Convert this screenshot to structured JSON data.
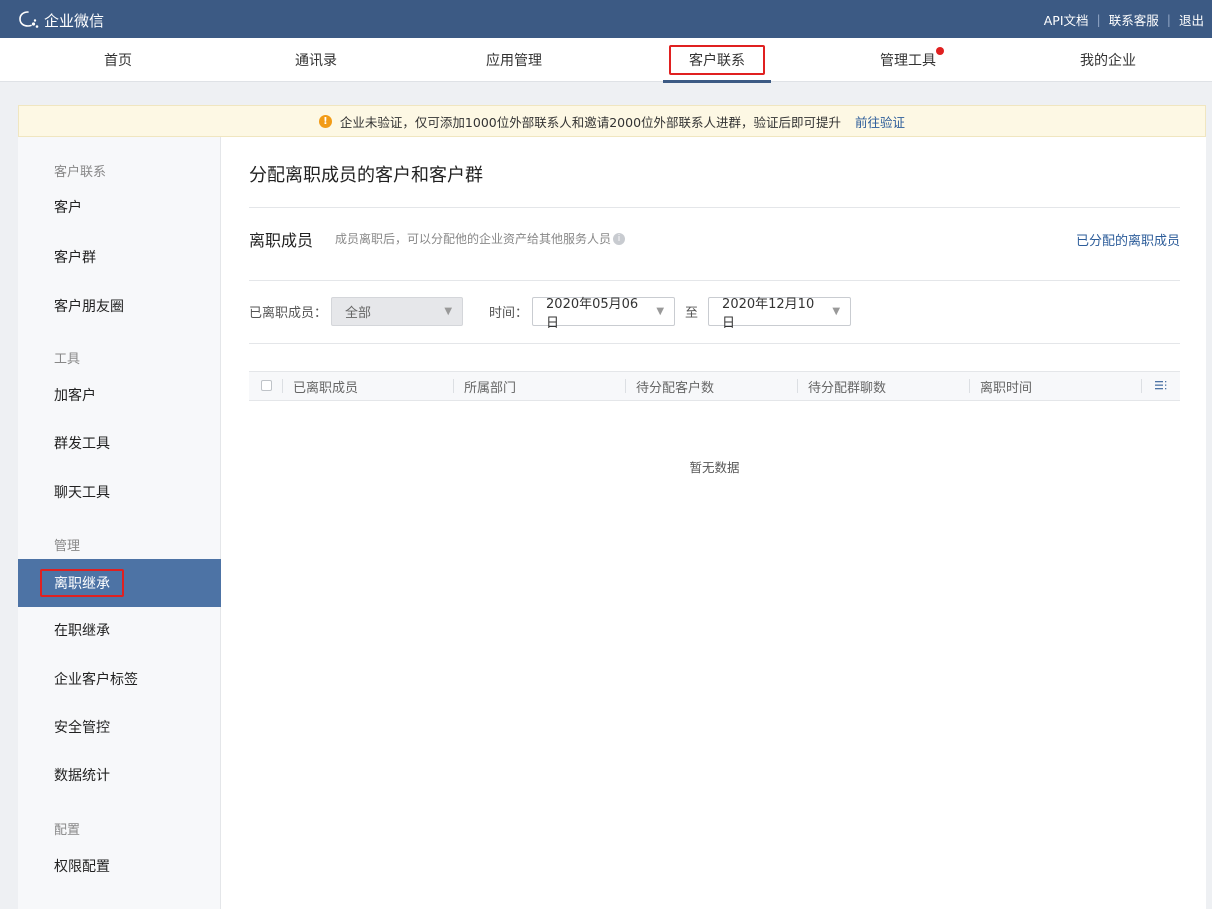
{
  "app": {
    "title": "企业微信"
  },
  "top_links": {
    "api_docs": "API文档",
    "contact_support": "联系客服",
    "logout": "退出"
  },
  "nav": {
    "items": [
      {
        "label": "首页"
      },
      {
        "label": "通讯录"
      },
      {
        "label": "应用管理"
      },
      {
        "label": "客户联系"
      },
      {
        "label": "管理工具"
      },
      {
        "label": "我的企业"
      }
    ],
    "active_index": 3
  },
  "notice": {
    "text": "企业未验证，仅可添加1000位外部联系人和邀请2000位外部联系人进群，验证后即可提升",
    "link": "前往验证"
  },
  "sidebar": {
    "groups": {
      "customer_contact": "客户联系",
      "tools": "工具",
      "manage": "管理",
      "config": "配置"
    },
    "items": {
      "customers": "客户",
      "customer_groups": "客户群",
      "moments": "客户朋友圈",
      "add_customer": "加客户",
      "mass_send": "群发工具",
      "chat_tools": "聊天工具",
      "resigned_inherit": "离职继承",
      "onjob_inherit": "在职继承",
      "tags": "企业客户标签",
      "security": "安全管控",
      "stats": "数据统计",
      "permissions": "权限配置"
    }
  },
  "main": {
    "page_title": "分配离职成员的客户和客户群",
    "section_title": "离职成员",
    "section_desc": "成员离职后，可以分配他的企业资产给其他服务人员",
    "assigned_link": "已分配的离职成员",
    "filters": {
      "member_label": "已离职成员：",
      "member_value": "全部",
      "time_label": "时间：",
      "start_date": "2020年05月06日",
      "to_label": "至",
      "end_date": "2020年12月10日"
    },
    "table": {
      "columns": [
        "已离职成员",
        "所属部门",
        "待分配客户数",
        "待分配群聊数",
        "离职时间"
      ],
      "empty_text": "暂无数据"
    }
  },
  "colors": {
    "topbar": "#3c5a84",
    "active_sidebar": "#4d73a5",
    "highlight_box": "#e02020",
    "link": "#2d5d9a",
    "notice_bg": "#fdf8e4"
  }
}
